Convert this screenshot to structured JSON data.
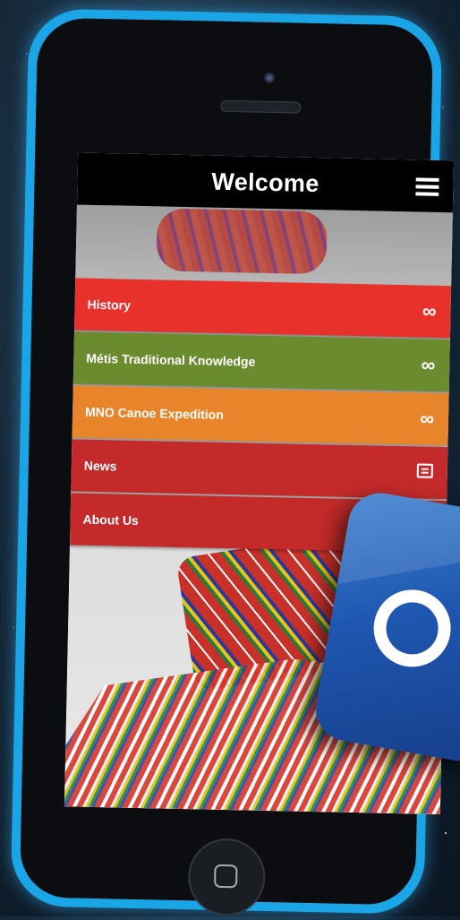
{
  "header": {
    "title": "Welcome",
    "menu_icon": "hamburger-icon"
  },
  "menu": {
    "items": [
      {
        "label": "History",
        "icon": "infinity-icon",
        "icon_glyph": "∞",
        "color": "#e8312a"
      },
      {
        "label": "Métis Traditional Knowledge",
        "icon": "infinity-icon",
        "icon_glyph": "∞",
        "color": "#6b8c2e"
      },
      {
        "label": "MNO Canoe Expedition",
        "icon": "infinity-icon",
        "icon_glyph": "∞",
        "color": "#e8842a"
      },
      {
        "label": "News",
        "icon": "news-icon",
        "icon_glyph": "",
        "color": "#c42a2a"
      },
      {
        "label": "About Us",
        "icon": "info-icon",
        "icon_glyph": "",
        "color": "#c42a2a"
      }
    ]
  },
  "colors": {
    "phone_frame": "#1aa6e6",
    "header_bg": "#000000",
    "app_tile": "#1f57b0"
  },
  "app_tile": {
    "icon": "infinity-logo-icon"
  }
}
